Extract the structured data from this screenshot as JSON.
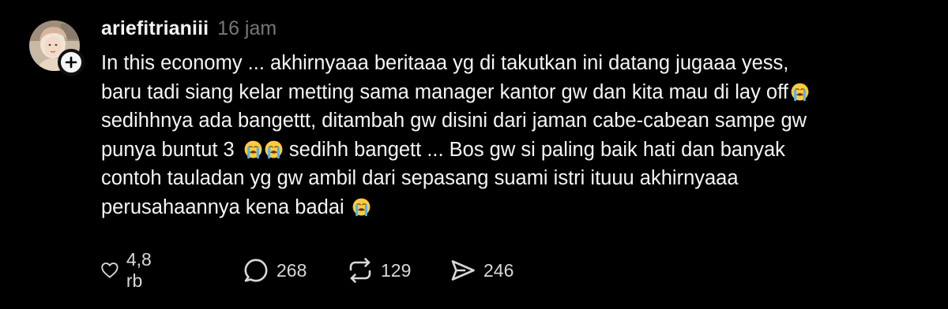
{
  "post": {
    "username": "ariefitrianiii",
    "timestamp": "16 jam",
    "avatar_icon": "profile-photo",
    "follow_icon": "plus-icon",
    "lines": [
      "In this economy ... akhirnyaaa beritaaa yg di takutkan ini datang jugaaa yess,",
      "baru tadi siang kelar metting sama manager kantor gw dan kita mau di lay off",
      "sedihhnya ada bangettt, ditambah gw disini dari jaman cabe-cabean sampe gw",
      "punya buntut 3",
      "sedihh bangett ... Bos gw si paling baik hati dan banyak",
      "contoh tauladan yg gw ambil dari sepasang suami istri ituuu akhirnyaaa",
      "perusahaannya kena badai"
    ],
    "emoji": "loudly-crying-face"
  },
  "actions": {
    "like_count": "4,8 rb",
    "reply_count": "268",
    "repost_count": "129",
    "share_count": "246"
  },
  "colors": {
    "background": "#000000",
    "text": "#f3f5f7",
    "muted": "#777777",
    "count": "#d8d8d8"
  }
}
